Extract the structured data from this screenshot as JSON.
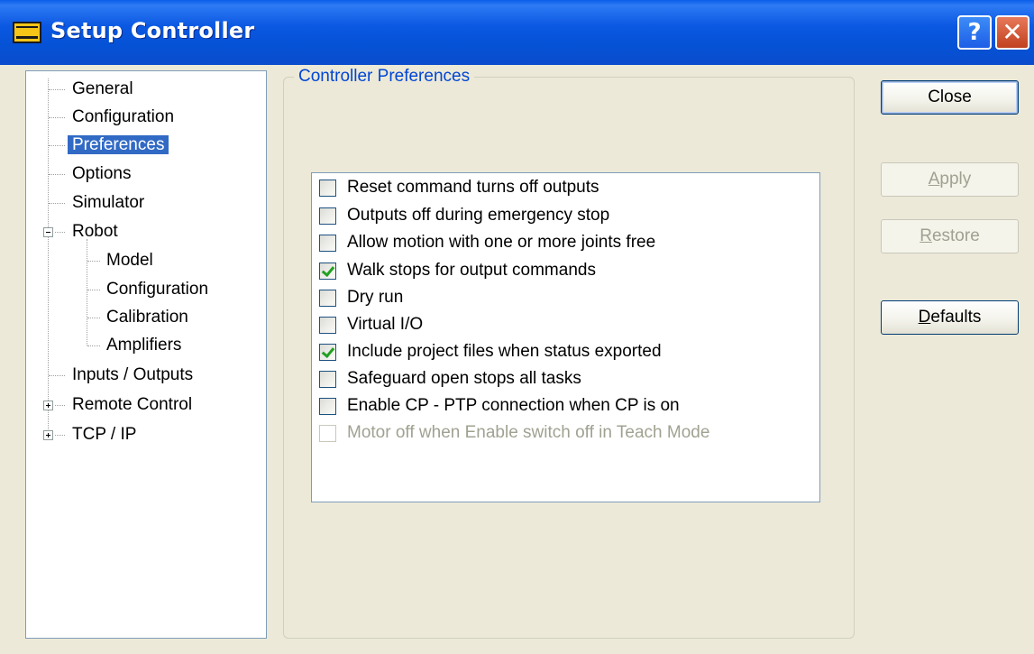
{
  "window": {
    "title": "Setup Controller",
    "help_label": "?",
    "close_label": "✕"
  },
  "tree": {
    "items": [
      {
        "label": "General"
      },
      {
        "label": "Configuration"
      },
      {
        "label": "Preferences",
        "selected": true
      },
      {
        "label": "Options"
      },
      {
        "label": "Simulator"
      },
      {
        "label": "Robot",
        "expander": "−"
      },
      {
        "label": "Model"
      },
      {
        "label": "Configuration"
      },
      {
        "label": "Calibration"
      },
      {
        "label": "Amplifiers"
      },
      {
        "label": "Inputs / Outputs"
      },
      {
        "label": "Remote Control",
        "expander": "+"
      },
      {
        "label": "TCP / IP",
        "expander": "+"
      }
    ]
  },
  "group": {
    "title": "Controller Preferences"
  },
  "options": [
    {
      "label": "Reset command turns off outputs",
      "checked": false,
      "enabled": true
    },
    {
      "label": "Outputs off during emergency stop",
      "checked": false,
      "enabled": true
    },
    {
      "label": "Allow motion with one or more joints free",
      "checked": false,
      "enabled": true
    },
    {
      "label": "Walk stops for output commands",
      "checked": true,
      "enabled": true
    },
    {
      "label": "Dry run",
      "checked": false,
      "enabled": true
    },
    {
      "label": "Virtual I/O",
      "checked": false,
      "enabled": true
    },
    {
      "label": "Include project files when status exported",
      "checked": true,
      "enabled": true
    },
    {
      "label": "Safeguard open stops all tasks",
      "checked": false,
      "enabled": true
    },
    {
      "label": "Enable CP - PTP connection when CP is on",
      "checked": false,
      "enabled": true
    },
    {
      "label": "Motor off when Enable switch off in Teach Mode",
      "checked": false,
      "enabled": false
    }
  ],
  "buttons": {
    "close": {
      "label": "Close"
    },
    "apply": {
      "mnemonic": "A",
      "rest": "pply"
    },
    "restore": {
      "mnemonic": "R",
      "rest": "estore"
    },
    "defaults": {
      "mnemonic": "D",
      "rest": "efaults"
    }
  }
}
